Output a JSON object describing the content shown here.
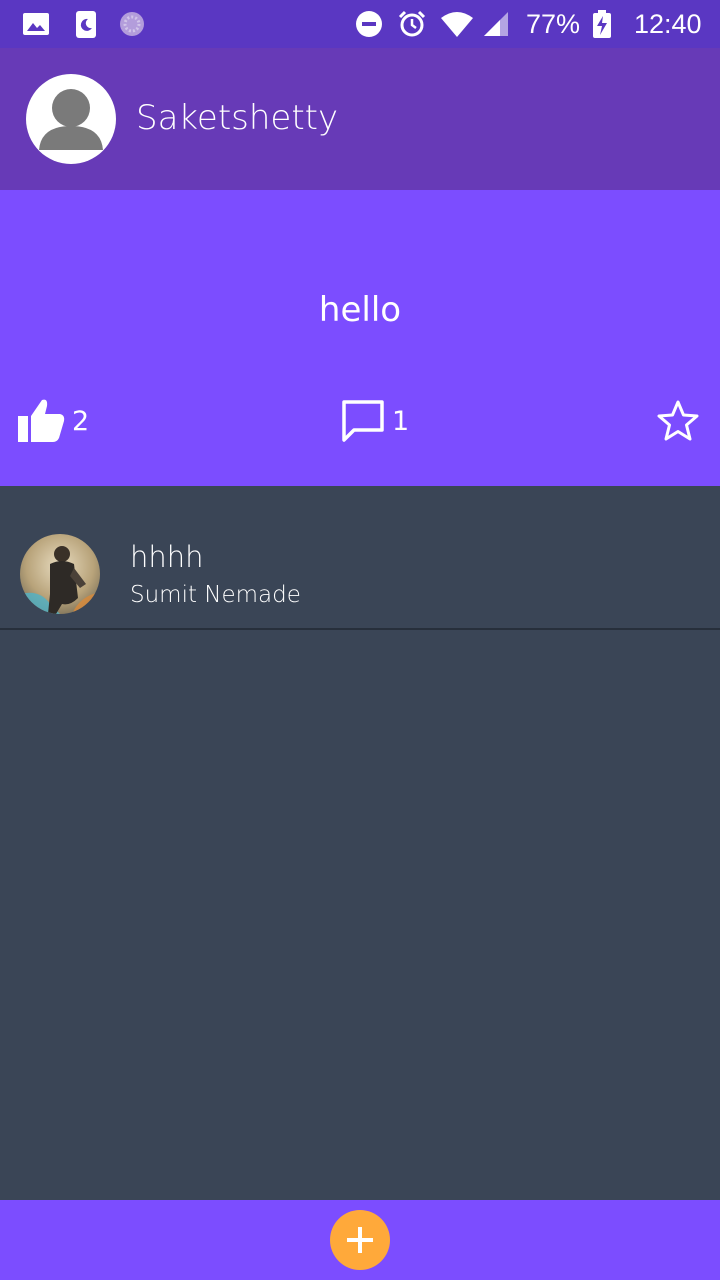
{
  "status_bar": {
    "battery": "77%",
    "time": "12:40",
    "icons": [
      "gallery-icon",
      "phone-moon-icon",
      "sync-icon",
      "do-not-disturb-icon",
      "alarm-icon",
      "wifi-icon",
      "signal-icon",
      "battery-icon"
    ]
  },
  "header": {
    "username": "Saketshetty",
    "avatar_icon": "default-avatar-icon"
  },
  "post": {
    "text": "hello",
    "likes": "2",
    "comments": "1",
    "icons": [
      "thumbs-up-icon",
      "comment-icon",
      "star-icon"
    ]
  },
  "comments": [
    {
      "text": "hhhh",
      "author": "Sumit Nemade"
    }
  ],
  "fab": {
    "icon": "plus-icon"
  },
  "colors": {
    "status_bar": "#5a37c2",
    "header": "#673ab7",
    "post_card": "#7c4dff",
    "background": "#3a4556",
    "fab": "#ffa93a"
  }
}
